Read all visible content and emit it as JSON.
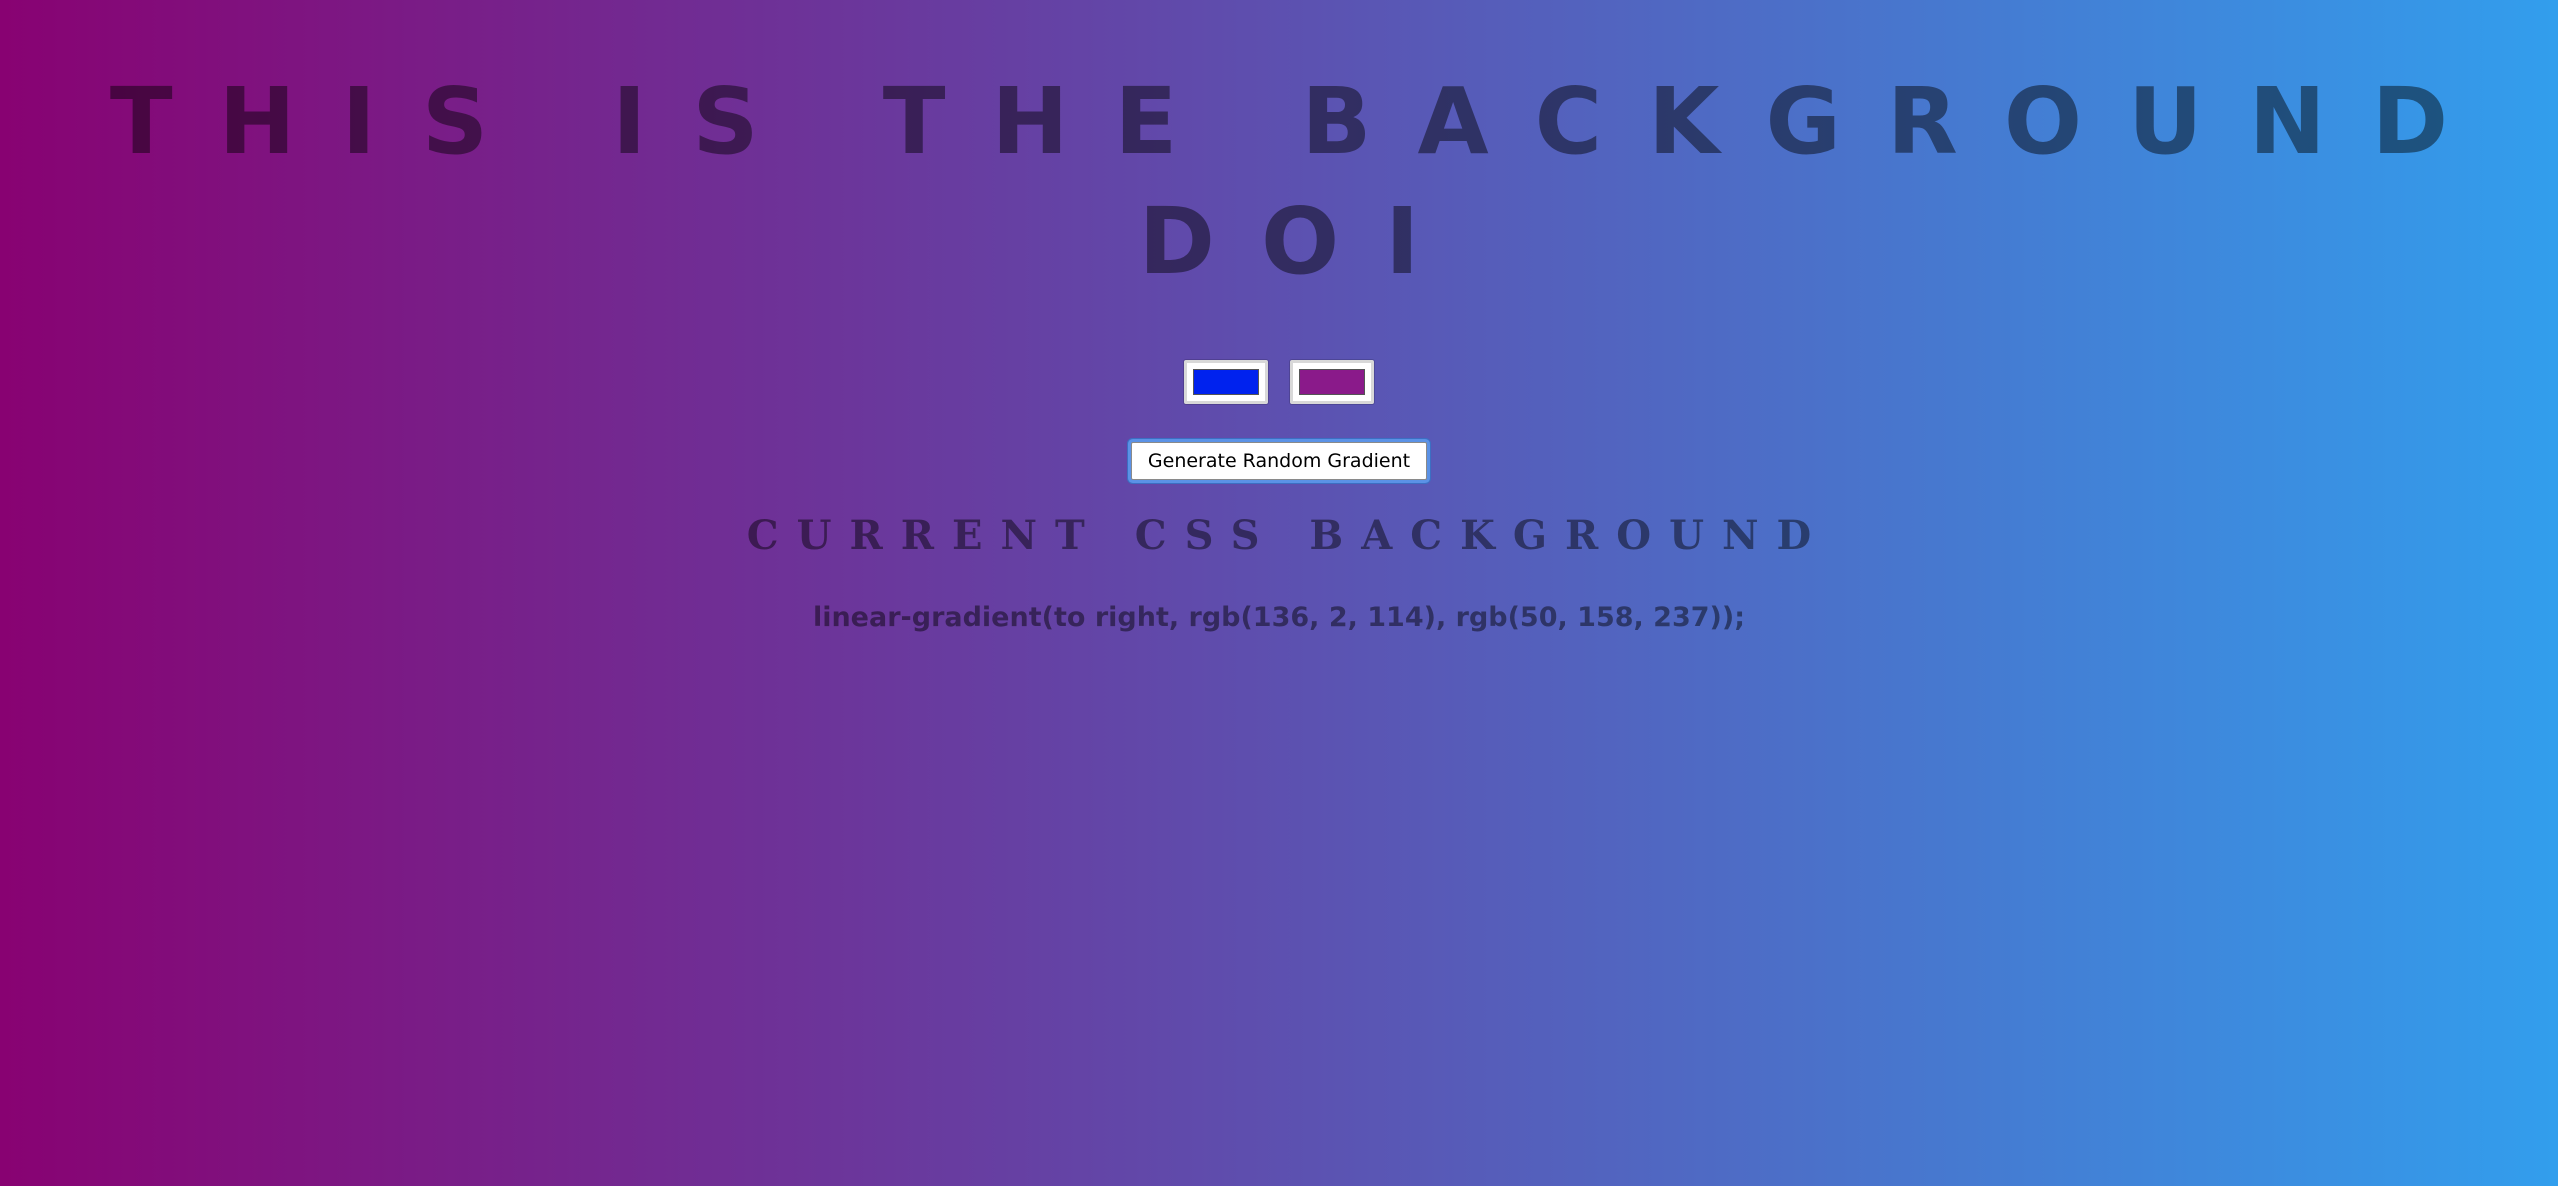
{
  "page": {
    "title": "THIS IS THE BACKGROUND DOI",
    "subtitle": "CURRENT CSS BACKGROUND",
    "css_output": "linear-gradient(to right, rgb(136, 2, 114), rgb(50, 158, 237));"
  },
  "colors": {
    "gradient_start": "#880272",
    "gradient_end": "#329eed",
    "picker_one": "#0022ee",
    "picker_two": "#8a1a8a",
    "focus_ring": "#5b92e6"
  },
  "controls": {
    "generate_label": "Generate Random Gradient"
  }
}
